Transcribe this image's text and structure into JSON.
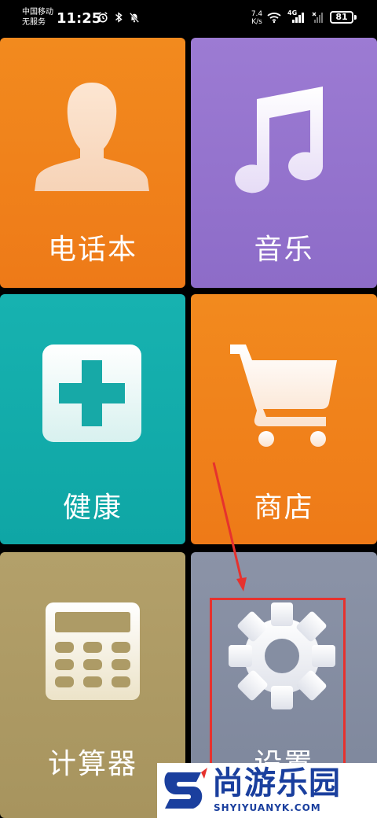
{
  "status_bar": {
    "carrier_line1": "中国移动",
    "carrier_line2": "无服务",
    "time": "11:25",
    "net_speed_value": "7.4",
    "net_speed_unit": "K/s",
    "network_type": "4G",
    "battery": "81"
  },
  "tiles": {
    "contacts": {
      "label": "电话本",
      "icon": "person-icon"
    },
    "music": {
      "label": "音乐",
      "icon": "music-note-icon"
    },
    "health": {
      "label": "健康",
      "icon": "medical-cross-icon"
    },
    "shop": {
      "label": "商店",
      "icon": "shopping-cart-icon"
    },
    "calculator": {
      "label": "计算器",
      "icon": "calculator-icon"
    },
    "settings": {
      "label": "设置",
      "icon": "gear-icon"
    }
  },
  "watermark": {
    "text": "尚游乐园",
    "sub": "SHYIYUANYK.COM"
  },
  "colors": {
    "orange": "#f28a1e",
    "purple": "#9c7bd3",
    "teal": "#17b2b0",
    "khaki": "#b3a06a",
    "slate": "#8b93a7",
    "annotation_red": "#e6322e",
    "watermark_blue": "#1a3f9e"
  }
}
